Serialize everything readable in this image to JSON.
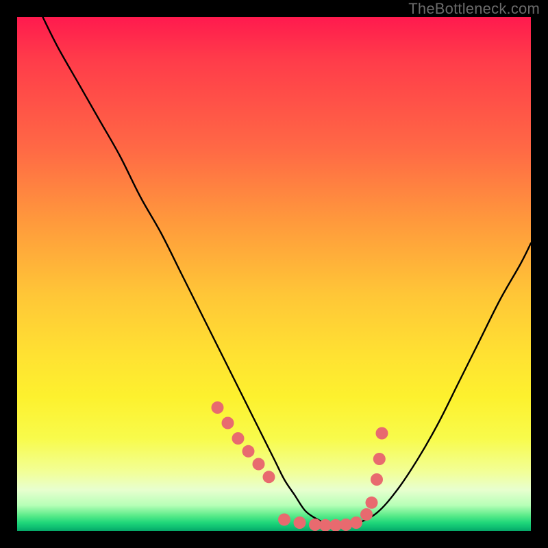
{
  "watermark": "TheBottleneck.com",
  "colors": {
    "marker": "#e86a6f",
    "curve": "#000000",
    "frame": "#000000"
  },
  "chart_data": {
    "type": "line",
    "title": "",
    "xlabel": "",
    "ylabel": "",
    "xlim": [
      0,
      100
    ],
    "ylim": [
      0,
      100
    ],
    "grid": false,
    "series": [
      {
        "name": "bottleneck-curve",
        "x": [
          5,
          8,
          12,
          16,
          20,
          24,
          28,
          32,
          36,
          40,
          44,
          47,
          50,
          52,
          54,
          56,
          58,
          60,
          62,
          64,
          66,
          70,
          74,
          78,
          82,
          86,
          90,
          94,
          98,
          100
        ],
        "y": [
          100,
          94,
          87,
          80,
          73,
          65,
          58,
          50,
          42,
          34,
          26,
          20,
          14,
          10,
          7,
          4,
          2.5,
          1.5,
          1,
          1,
          1.4,
          3.5,
          8,
          14,
          21,
          29,
          37,
          45,
          52,
          56
        ]
      }
    ],
    "markers": {
      "name": "highlight-dots",
      "x": [
        39,
        41,
        43,
        45,
        47,
        49,
        52,
        55,
        58,
        60,
        62,
        64,
        66,
        68,
        69,
        70,
        70.5,
        71
      ],
      "y": [
        24,
        21,
        18,
        15.5,
        13,
        10.5,
        2.2,
        1.6,
        1.2,
        1.1,
        1.1,
        1.2,
        1.6,
        3.2,
        5.5,
        10,
        14,
        19
      ]
    }
  }
}
